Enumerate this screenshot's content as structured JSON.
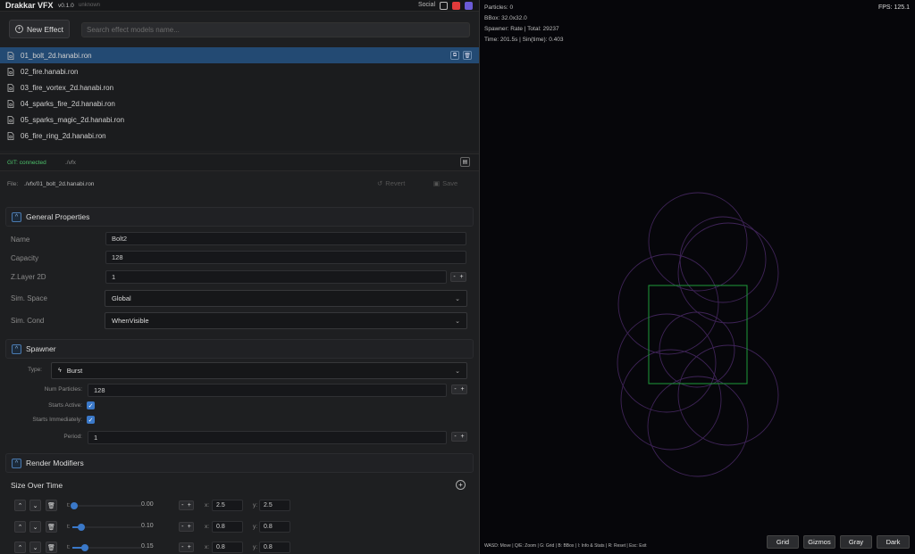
{
  "app": {
    "title": "Drakkar VFX",
    "version": "v0.1.0",
    "build": "unknown",
    "social_label": "Social",
    "social_icons": [
      "github-icon",
      "youtube-icon",
      "discord-icon"
    ],
    "colors": {
      "youtube": "#e23b3b",
      "discord": "#6b5bd6",
      "accent": "#3a78c8",
      "selection": "#234a73",
      "git_ok": "#4cc06a"
    }
  },
  "toolbar": {
    "new_effect_label": "New Effect",
    "search_placeholder": "Search effect models name..."
  },
  "files": [
    {
      "name": "01_bolt_2d.hanabi.ron",
      "selected": true
    },
    {
      "name": "02_fire.hanabi.ron",
      "selected": false
    },
    {
      "name": "03_fire_vortex_2d.hanabi.ron",
      "selected": false
    },
    {
      "name": "04_sparks_fire_2d.hanabi.ron",
      "selected": false
    },
    {
      "name": "05_sparks_magic_2d.hanabi.ron",
      "selected": false
    },
    {
      "name": "06_fire_ring_2d.hanabi.ron",
      "selected": false
    }
  ],
  "git": {
    "status": "GIT: connected",
    "path": "./vfx"
  },
  "file_bar": {
    "label": "File:",
    "path": "./vfx/01_bolt_2d.hanabi.ron",
    "revert_label": "Revert",
    "save_label": "Save"
  },
  "general": {
    "title": "General Properties",
    "name_label": "Name",
    "name_value": "Bolt2",
    "capacity_label": "Capacity",
    "capacity_value": "128",
    "zlayer_label": "Z.Layer 2D",
    "zlayer_value": "1",
    "simspace_label": "Sim. Space",
    "simspace_value": "Global",
    "simcond_label": "Sim. Cond",
    "simcond_value": "WhenVisible"
  },
  "spawner": {
    "title": "Spawner",
    "type_label": "Type:",
    "type_value": "Burst",
    "num_label": "Num Particles:",
    "num_value": "128",
    "starts_active_label": "Starts Active:",
    "starts_active": true,
    "starts_immediately_label": "Starts Immediately:",
    "starts_immediately": true,
    "period_label": "Period:",
    "period_value": "1"
  },
  "render": {
    "title": "Render Modifiers",
    "size_title": "Size Over Time",
    "keyframes": [
      {
        "t": "0.00",
        "t_fraction": 0.0,
        "x": "2.5",
        "y": "2.5"
      },
      {
        "t": "0.10",
        "t_fraction": 0.1,
        "x": "0.8",
        "y": "0.8"
      },
      {
        "t": "0.15",
        "t_fraction": 0.15,
        "x": "0.8",
        "y": "0.8"
      }
    ],
    "t_label": "t:",
    "x_label": "x:",
    "y_label": "y:"
  },
  "viewport": {
    "particles": "Particles: 0",
    "bbox": "BBox: 32.0x32.0",
    "spawner": "Spawner: Rate | Total: 29237",
    "time": "Time: 201.5s | Sin(time): 0.403",
    "fps": "FPS: 125.1",
    "help": "WASD: Move | Q/E: Zoom | G: Grid | B: BBox | I: Info & Stats | R: Reset | Esc: Exit",
    "buttons": [
      "Grid",
      "Gizmos",
      "Gray",
      "Dark"
    ],
    "colors": {
      "bbox": "#1f9a3a",
      "circles": "#4a2a66"
    }
  }
}
